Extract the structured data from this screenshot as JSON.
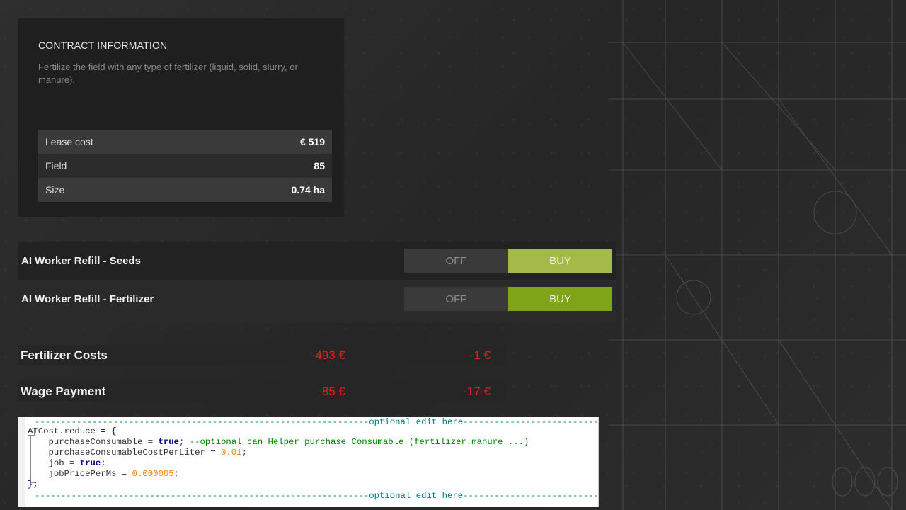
{
  "contract": {
    "title": "CONTRACT INFORMATION",
    "description": "Fertilize the field with any type of fertilizer (liquid, solid, slurry, or manure).",
    "rows": [
      {
        "label": "Lease cost",
        "value": "€ 519"
      },
      {
        "label": "Field",
        "value": "85"
      },
      {
        "label": "Size",
        "value": "0.74 ha"
      }
    ]
  },
  "workers": [
    {
      "label": "AI Worker Refill - Seeds",
      "off": "OFF",
      "buy": "BUY",
      "buy_color": "#a3b94a"
    },
    {
      "label": "AI Worker Refill - Fertilizer",
      "off": "OFF",
      "buy": "BUY",
      "buy_color": "#7fa516"
    }
  ],
  "costs": [
    {
      "label": "Fertilizer Costs",
      "value1": "-493 €",
      "value2": "-1 €"
    },
    {
      "label": "Wage Payment",
      "value1": "-85 €",
      "value2": "-17 €"
    }
  ],
  "code": {
    "header": "----------------------------------------------------------------optional edit here-----------------------------------------------------------",
    "line1_name": "AICost.reduce",
    "line1_rest": " = {",
    "line2_a": "    purchaseConsumable = ",
    "line2_kw": "true",
    "line2_b": "; ",
    "line2_comment": "--optional can Helper purchase Consumable (fertilizer.manure ...)",
    "line3_a": "    purchaseConsumableCostPerLiter = ",
    "line3_num": "0.01",
    "line3_b": ";",
    "line4_a": "    job = ",
    "line4_kw": "true",
    "line4_b": ";",
    "line5_a": "    jobPricePerMs = ",
    "line5_num": "0.000005",
    "line5_b": ";",
    "line6": "};",
    "footer": "----------------------------------------------------------------optional edit here-----------------------------------------------------------"
  },
  "colors": {
    "negative": "#d9261c",
    "buy_light": "#a3b94a",
    "buy_dark": "#7fa516"
  }
}
